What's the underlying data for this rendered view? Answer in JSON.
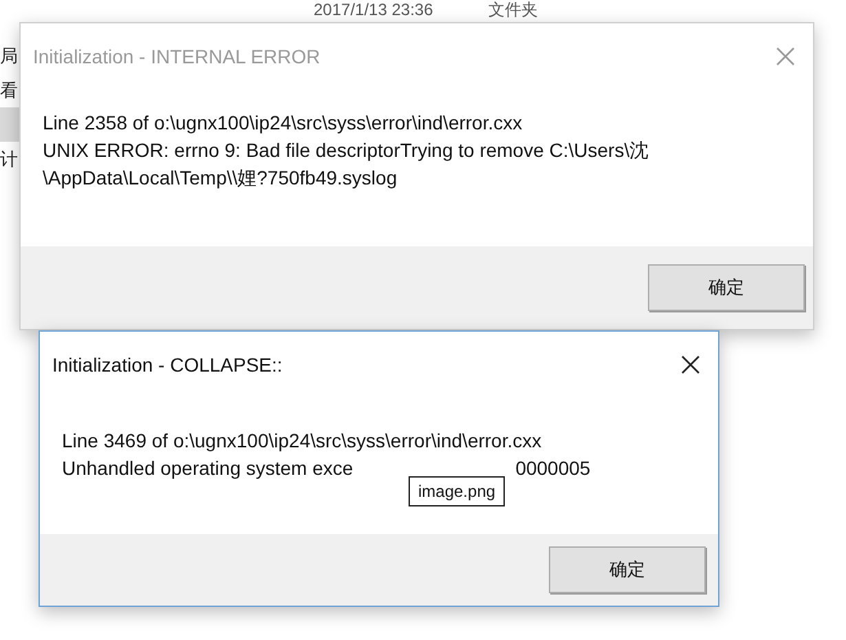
{
  "background": {
    "timestamp": "2017/1/13 23:36",
    "type": "文件夹",
    "side_items": [
      {
        "label": "局",
        "selected": false
      },
      {
        "label": "看",
        "selected": false
      },
      {
        "selected": true
      },
      {
        "label": "计",
        "selected": false
      }
    ]
  },
  "dialogs": [
    {
      "title": "Initialization - INTERNAL ERROR",
      "active": false,
      "lines": [
        [
          "Line 2358 of o:\\ugnx100\\ip24\\src\\syss\\error\\ind\\error.cxx"
        ],
        [
          "UNIX ERROR: errno 9: Bad file descriptorTrying to remove C:\\Users\\沈"
        ],
        [
          "\\AppData\\Local\\Temp\\\\娌?750fb49.syslog"
        ]
      ],
      "button": "确定"
    },
    {
      "title": "Initialization - COLLAPSE::",
      "active": true,
      "lines": [
        [
          "Line 3469 of o:\\ugnx100\\ip24\\src\\syss\\error\\ind\\error.cxx"
        ],
        [
          "Unhandled operating system exce",
          "0000005"
        ]
      ],
      "button": "确定"
    }
  ],
  "tooltip": "image.png"
}
